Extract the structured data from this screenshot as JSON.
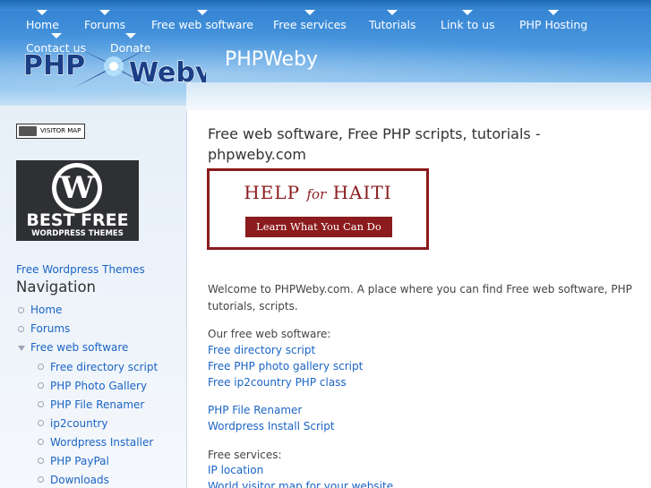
{
  "header": {
    "nav": [
      "Home",
      "Forums",
      "Free web software",
      "Free services",
      "Tutorials",
      "Link to us",
      "PHP Hosting"
    ],
    "nav_row2": [
      "Contact us",
      "Donate"
    ],
    "logo": {
      "left": "PHP",
      "right": "Weby"
    },
    "site_name": "PHPWeby"
  },
  "sidebar": {
    "visitor_map_label": "VISITOR MAP",
    "wp_banner": {
      "title": "BEST FREE",
      "subtitle": "WORDPRESS THEMES"
    },
    "wp_link": "Free Wordpress Themes",
    "navigation_title": "Navigation",
    "menu": [
      "Home",
      "Forums",
      "Free web software"
    ],
    "submenu": [
      "Free directory script",
      "PHP Photo Gallery",
      "PHP File Renamer",
      "ip2country",
      "Wordpress Installer",
      "PHP PayPal",
      "Downloads"
    ]
  },
  "main": {
    "title": "Free web software, Free PHP scripts, tutorials - phpweby.com",
    "haiti": {
      "line1a": "HELP",
      "line1b": "for",
      "line1c": "HAITI",
      "button": "Learn What You Can Do"
    },
    "welcome_line1": "Welcome to PHPWeby.com. A place where you can find Free web software, PHP",
    "welcome_line2": "tutorials, scripts.",
    "software_heading": "Our free web software:",
    "software_links": [
      "Free directory script",
      "Free PHP photo gallery script",
      "Free ip2country PHP class"
    ],
    "more_links": [
      "PHP File Renamer",
      "Wordpress Install Script"
    ],
    "services_heading": "Free services:",
    "services_links": [
      "IP location",
      "World visitor map for your website"
    ]
  },
  "colors": {
    "link": "#1b64c4",
    "header_blue": "#3c8bd6",
    "haiti_red": "#8b1b1d"
  }
}
